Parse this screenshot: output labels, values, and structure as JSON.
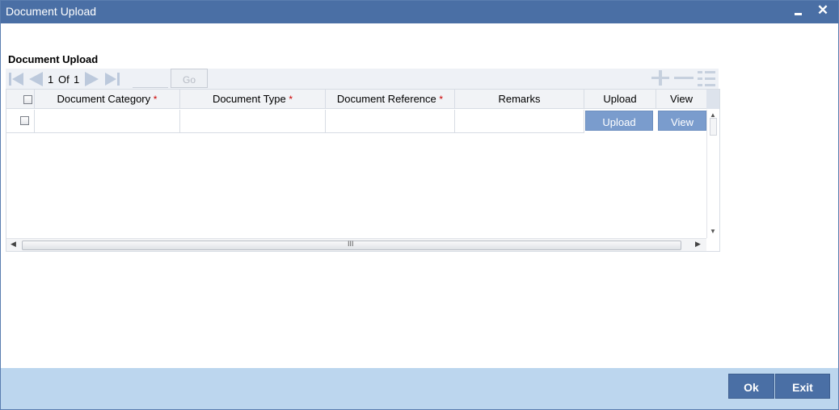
{
  "window": {
    "title": "Document Upload",
    "close_glyph": "✕"
  },
  "section": {
    "title": "Document Upload"
  },
  "pagination": {
    "current": "1",
    "of_label": "Of",
    "total": "1",
    "go_label": "Go"
  },
  "grid": {
    "columns": [
      {
        "label": "Document Category",
        "required": true
      },
      {
        "label": "Document Type",
        "required": true
      },
      {
        "label": "Document Reference",
        "required": true
      },
      {
        "label": "Remarks",
        "required": false
      },
      {
        "label": "Upload",
        "required": false
      },
      {
        "label": "View",
        "required": false
      }
    ],
    "required_marker": "*",
    "row": {
      "upload_label": "Upload",
      "view_label": "View"
    },
    "scroll": {
      "up": "▲",
      "down": "▼",
      "left": "◀",
      "right": "▶",
      "grip": "III"
    }
  },
  "footer": {
    "ok_label": "Ok",
    "exit_label": "Exit"
  },
  "colors": {
    "titlebar": "#4a6fa5",
    "footer": "#bcd6ee",
    "grid_button": "#7a9ccd",
    "required": "#cc0000"
  },
  "icons": [
    "minimize-icon",
    "close-icon",
    "first-page-icon",
    "prev-page-icon",
    "next-page-icon",
    "last-page-icon",
    "add-row-icon",
    "delete-row-icon",
    "single-view-icon"
  ]
}
